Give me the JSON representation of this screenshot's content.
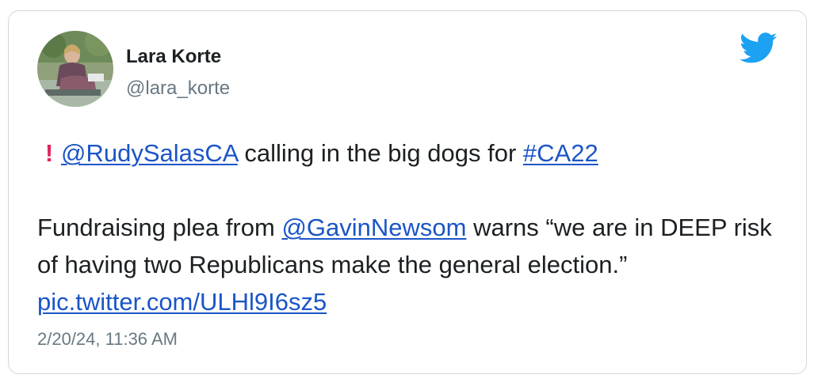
{
  "tweet": {
    "author_name": "Lara Korte",
    "author_handle": "@lara_korte",
    "line1": {
      "alert_icon": "red-exclamation-icon",
      "mention": "@RudySalasCA",
      "text": " calling in the big dogs for ",
      "hashtag": "#CA22"
    },
    "line2": {
      "text_before": "Fundraising plea from ",
      "mention": "@GavinNewsom",
      "text_after": " warns “we are in DEEP risk of having two Republicans make the general election.” ",
      "link": "pic.twitter.com/ULHl9I6sz5"
    },
    "timestamp": "2/20/24, 11:36 AM"
  },
  "icons": {
    "brand": "twitter-bird-icon",
    "avatar": "avatar-photo"
  },
  "colors": {
    "link": "#1b55c7",
    "twitter_blue": "#1da1f2",
    "alert_red": "#e0245e",
    "secondary_text": "#697882",
    "border": "#cfd9de"
  }
}
